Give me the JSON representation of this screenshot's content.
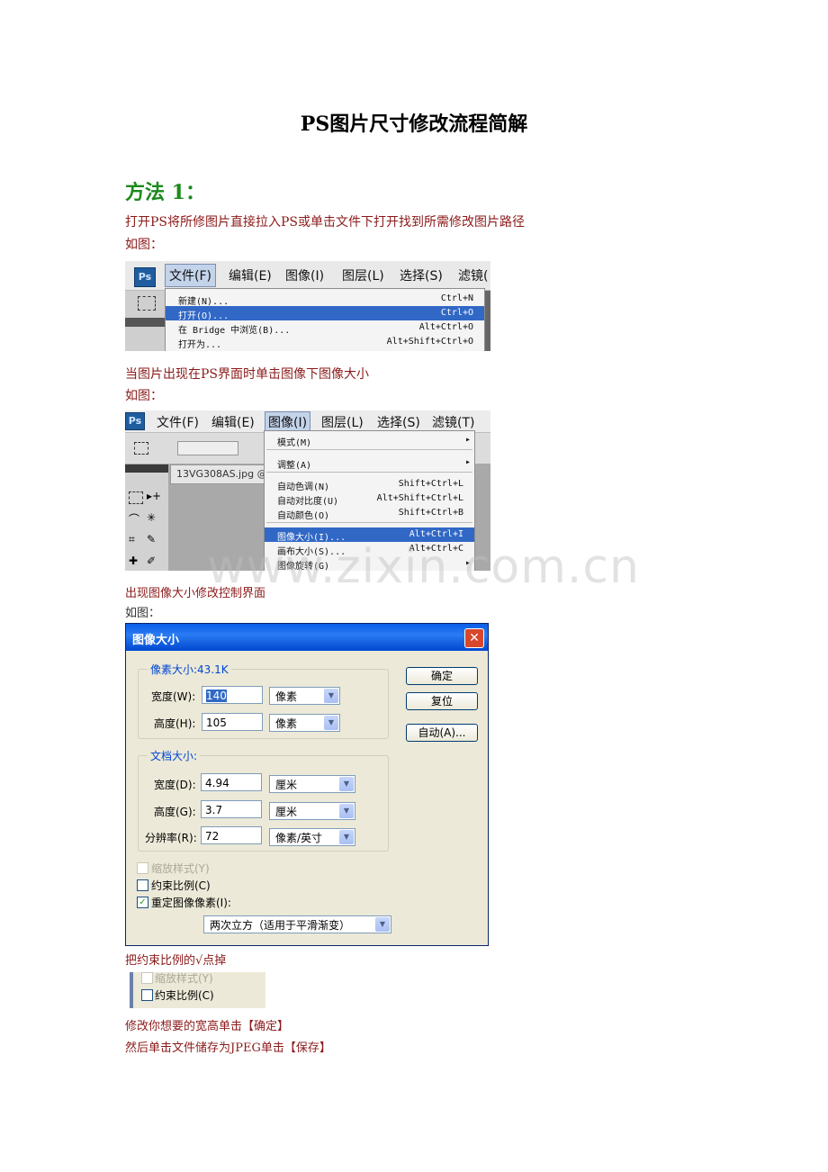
{
  "doc": {
    "title": "PS图片尺寸修改流程简解",
    "method_heading": "方法 1：",
    "step1": "打开PS将所修图片直接拉入PS或单击文件下打开找到所需修改图片路径",
    "ruxia": "如图：",
    "step2": "当图片出现在PS界面时单击图像下图像大小",
    "step3": "出现图像大小修改控制界面",
    "step4": "把约束比例的√点掉",
    "step5": "修改你想要的宽高单击【确定】",
    "step6": "然后单击文件储存为JPEG单击【保存】",
    "watermark": "www.zixin.com.cn"
  },
  "shot1": {
    "logo": "Ps",
    "menu": [
      "文件(F)",
      "编辑(E)",
      "图像(I)",
      "图层(L)",
      "选择(S)",
      "滤镜("
    ],
    "items": [
      {
        "label": "新建(N)...",
        "shortcut": "Ctrl+N"
      },
      {
        "label": "打开(O)...",
        "shortcut": "Ctrl+O"
      },
      {
        "label": "在 Bridge 中浏览(B)...",
        "shortcut": "Alt+Ctrl+O"
      },
      {
        "label": "打开为...",
        "shortcut": "Alt+Shift+Ctrl+O"
      }
    ]
  },
  "shot2": {
    "logo": "Ps",
    "menu": [
      "文件(F)",
      "编辑(E)",
      "图像(I)",
      "图层(L)",
      "选择(S)",
      "滤镜(T)"
    ],
    "tab_name": "13VG308AS.jpg @",
    "items": [
      {
        "label": "模式(M)",
        "shortcut": "▸"
      },
      {
        "label": "调整(A)",
        "shortcut": "▸"
      },
      {
        "label": "自动色调(N)",
        "shortcut": "Shift+Ctrl+L"
      },
      {
        "label": "自动对比度(U)",
        "shortcut": "Alt+Shift+Ctrl+L"
      },
      {
        "label": "自动颜色(O)",
        "shortcut": "Shift+Ctrl+B"
      },
      {
        "label": "图像大小(I)...",
        "shortcut": "Alt+Ctrl+I"
      },
      {
        "label": "画布大小(S)...",
        "shortcut": "Alt+Ctrl+C"
      },
      {
        "label": "图像旋转(G)",
        "shortcut": "▸"
      }
    ]
  },
  "dialog": {
    "title": "图像大小",
    "close": "✕",
    "pixel_group": "像素大小:43.1K",
    "width_label": "宽度(W):",
    "width_value": "140",
    "height_label": "高度(H):",
    "height_value": "105",
    "pixel_unit": "像素",
    "doc_group": "文档大小:",
    "doc_width_label": "宽度(D):",
    "doc_width_value": "4.94",
    "doc_height_label": "高度(G):",
    "doc_height_value": "3.7",
    "cm_unit": "厘米",
    "res_label": "分辨率(R):",
    "res_value": "72",
    "res_unit": "像素/英寸",
    "scale_styles": "缩放样式(Y)",
    "constrain": "约束比例(C)",
    "resample": "重定图像像素(I):",
    "method": "两次立方（适用于平滑渐变）",
    "ok": "确定",
    "reset": "复位",
    "auto": "自动(A)...",
    "check_mark": "✓"
  },
  "snippet": {
    "scale_styles": "缩放样式(Y)",
    "constrain": "约束比例(C)"
  }
}
